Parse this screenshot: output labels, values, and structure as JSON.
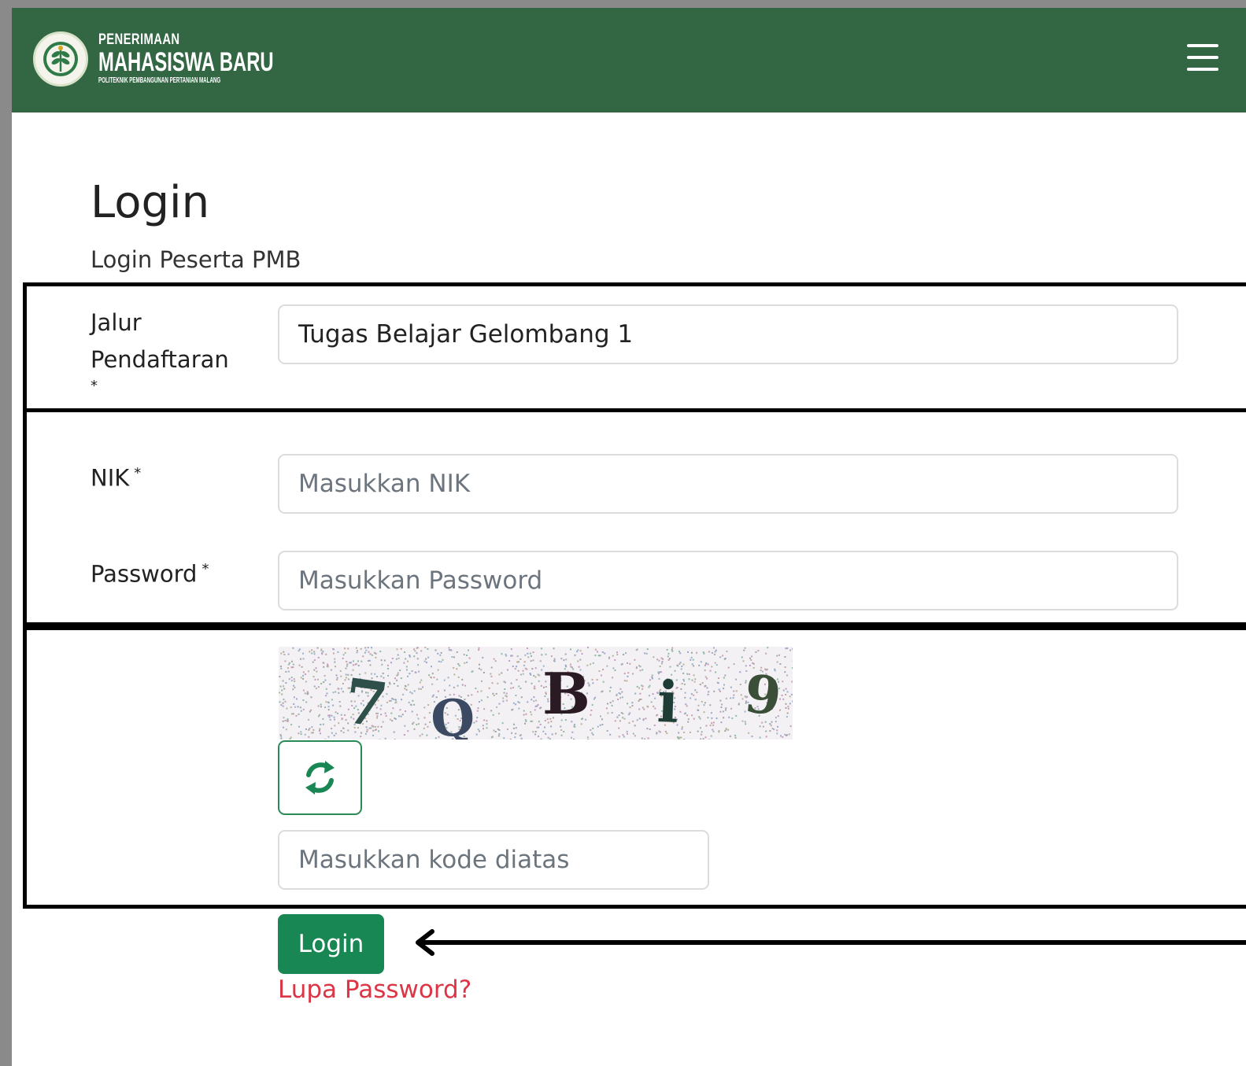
{
  "header": {
    "brand_line1": "PENERIMAAN",
    "brand_line2": "MAHASISWA BARU",
    "brand_line3": "POLITEKNIK PEMBANGUNAN PERTANIAN MALANG",
    "menu_icon": "hamburger-menu-icon",
    "logo": "institution-logo"
  },
  "main": {
    "title": "Login",
    "subtitle": "Login Peserta PMB",
    "form": {
      "jalur_label_line1": "Jalur",
      "jalur_label_line2": "Pendaftaran",
      "jalur_required": "*",
      "jalur_value": "Tugas Belajar Gelombang 1",
      "nik_label": "NIK",
      "nik_required": "*",
      "nik_placeholder": "Masukkan NIK",
      "password_label": "Password",
      "password_required": "*",
      "password_placeholder": "Masukkan Password",
      "captcha_text": "7QBi9",
      "captcha_chars": [
        "7",
        "Q",
        "B",
        "i",
        "9"
      ],
      "refresh_icon": "refresh-icon",
      "captcha_placeholder": "Masukkan kode diatas",
      "login_label": "Login",
      "forgot_label": "Lupa Password?"
    }
  },
  "colors": {
    "header_bg": "#336643",
    "primary": "#198754",
    "danger": "#dc3545",
    "annotation": "#000000"
  }
}
